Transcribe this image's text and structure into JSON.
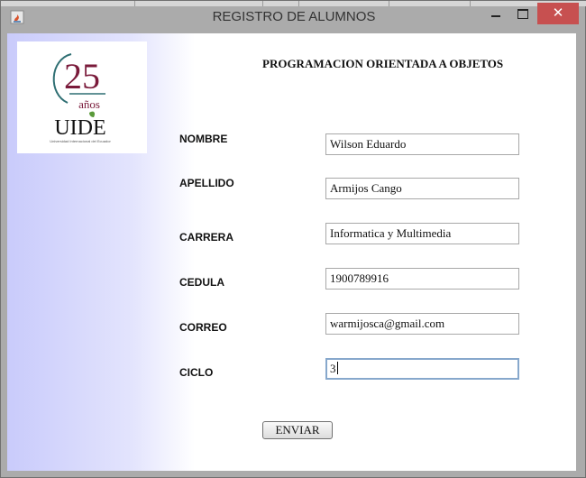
{
  "window": {
    "title": "REGISTRO DE ALUMNOS",
    "close_glyph": "✕"
  },
  "logo": {
    "number": "25",
    "sub": "años",
    "brand": "UIDE",
    "tagline": "Universidad Internacional del Ecuador",
    "colors": {
      "maroon": "#7a1a3a",
      "green": "#5a9a3a",
      "teal": "#2f6f73"
    }
  },
  "form": {
    "heading": "PROGRAMACION ORIENTADA A OBJETOS",
    "fields": [
      {
        "label": "NOMBRE",
        "value": "Wilson Eduardo"
      },
      {
        "label": "APELLIDO",
        "value": "Armijos Cango"
      },
      {
        "label": "CARRERA",
        "value": "Informatica y Multimedia"
      },
      {
        "label": "CEDULA",
        "value": "1900789916"
      },
      {
        "label": "CORREO",
        "value": "warmijosca@gmail.com"
      },
      {
        "label": "CICLO",
        "value": "3"
      }
    ],
    "submit_label": "ENVIAR"
  },
  "colors": {
    "panel_gradient_start": "#c9cbfb",
    "close_button": "#c75050",
    "focus_border": "#87a8cc"
  }
}
